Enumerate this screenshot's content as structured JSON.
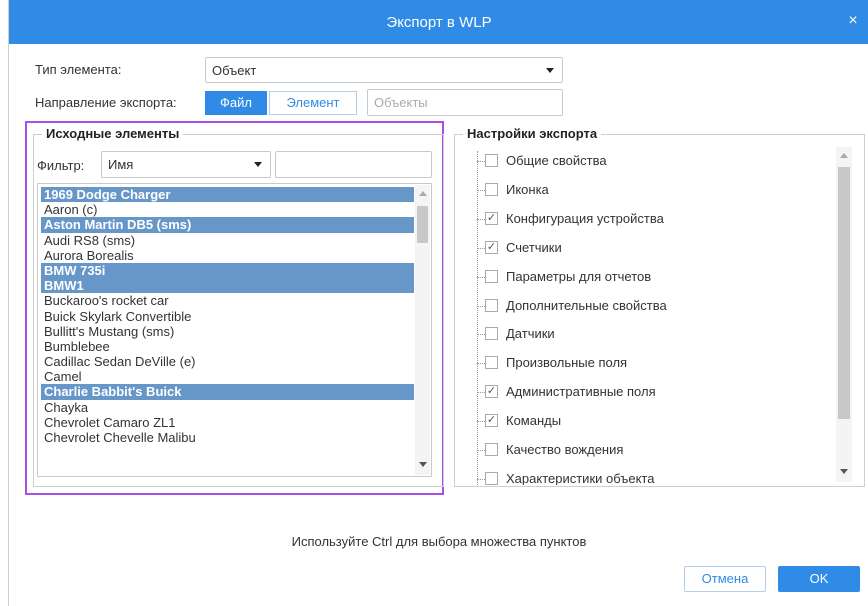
{
  "window": {
    "title": "Экспорт в WLP",
    "close_symbol": "×"
  },
  "form": {
    "type_label": "Тип элемента:",
    "type_value": "Объект",
    "direction_label": "Направление экспорта:",
    "direction_tabs": [
      "Файл",
      "Элемент"
    ],
    "direction_active": "Файл",
    "objects_placeholder": "Объекты"
  },
  "source": {
    "legend": "Исходные элементы",
    "filter_label": "Фильтр:",
    "filter_value": "Имя",
    "filter_text": "",
    "items": [
      {
        "label": "1969 Dodge Charger",
        "selected": true
      },
      {
        "label": "Aaron (c)",
        "selected": false
      },
      {
        "label": "Aston Martin DB5 (sms)",
        "selected": true
      },
      {
        "label": "Audi RS8 (sms)",
        "selected": false
      },
      {
        "label": "Aurora Borealis",
        "selected": false
      },
      {
        "label": "BMW 735i",
        "selected": true
      },
      {
        "label": "BMW1",
        "selected": true
      },
      {
        "label": "Buckaroo's rocket car",
        "selected": false
      },
      {
        "label": "Buick Skylark Convertible",
        "selected": false
      },
      {
        "label": "Bullitt's Mustang (sms)",
        "selected": false
      },
      {
        "label": "Bumblebee",
        "selected": false
      },
      {
        "label": "Cadillac Sedan DeVille (e)",
        "selected": false
      },
      {
        "label": "Camel",
        "selected": false
      },
      {
        "label": "Charlie Babbit's Buick",
        "selected": true
      },
      {
        "label": "Chayka",
        "selected": false
      },
      {
        "label": "Chevrolet Camaro ZL1",
        "selected": false
      },
      {
        "label": "Chevrolet Chevelle Malibu",
        "selected": false
      }
    ]
  },
  "settings": {
    "legend": "Настройки экспорта",
    "items": [
      {
        "label": "Общие свойства",
        "checked": false
      },
      {
        "label": "Иконка",
        "checked": false
      },
      {
        "label": "Конфигурация устройства",
        "checked": true
      },
      {
        "label": "Счетчики",
        "checked": true
      },
      {
        "label": "Параметры для отчетов",
        "checked": false
      },
      {
        "label": "Дополнительные свойства",
        "checked": false
      },
      {
        "label": "Датчики",
        "checked": false
      },
      {
        "label": "Произвольные поля",
        "checked": false
      },
      {
        "label": "Административные поля",
        "checked": true
      },
      {
        "label": "Команды",
        "checked": true
      },
      {
        "label": "Качество вождения",
        "checked": false
      },
      {
        "label": "Характеристики объекта",
        "checked": false
      }
    ]
  },
  "footer": {
    "hint": "Используйте Ctrl для выбора множества пунктов",
    "cancel_label": "Отмена",
    "ok_label": "OK"
  },
  "colors": {
    "accent": "#2f8be5",
    "selection": "#6796c8",
    "highlight_frame": "#a94ee6"
  }
}
